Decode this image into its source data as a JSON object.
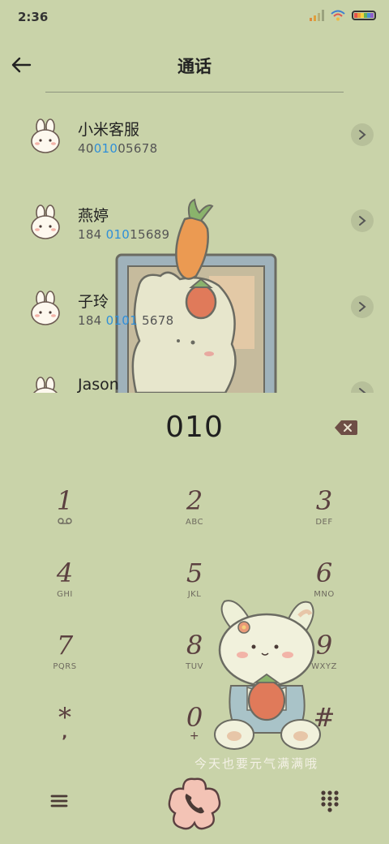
{
  "status": {
    "time": "2:36"
  },
  "header": {
    "title": "通话"
  },
  "contacts": [
    {
      "name": "小米客服",
      "number_pre": "40",
      "number_hl": "010",
      "number_post": "05678"
    },
    {
      "name": "燕婷",
      "number_pre": "184 ",
      "number_hl": "010",
      "number_post": "15689"
    },
    {
      "name": "子玲",
      "number_pre": "184 ",
      "number_hl": "0101",
      "number_post": " 5678"
    },
    {
      "name": "Jason",
      "number_pre": "",
      "number_hl": "",
      "number_post": ""
    }
  ],
  "dial": {
    "number": "010"
  },
  "keys": [
    {
      "digit": "1",
      "letters": ""
    },
    {
      "digit": "2",
      "letters": "ABC"
    },
    {
      "digit": "3",
      "letters": "DEF"
    },
    {
      "digit": "4",
      "letters": "GHI"
    },
    {
      "digit": "5",
      "letters": "JKL"
    },
    {
      "digit": "6",
      "letters": "MNO"
    },
    {
      "digit": "7",
      "letters": "PQRS"
    },
    {
      "digit": "8",
      "letters": "TUV"
    },
    {
      "digit": "9",
      "letters": "WXYZ"
    },
    {
      "digit": "*",
      "letters": ","
    },
    {
      "digit": "0",
      "letters": "+"
    },
    {
      "digit": "#",
      "letters": ""
    }
  ],
  "wallpaper": {
    "slogan": "今天也要元气满满哦"
  },
  "icons": {
    "back": "arrow-left-icon",
    "detail": "chevron-right-icon",
    "backspace": "backspace-icon",
    "voicemail": "voicemail-icon",
    "menu": "menu-icon",
    "call": "phone-icon",
    "keypad": "dialpad-icon"
  },
  "colors": {
    "background": "#c9d3a9",
    "highlight": "#2f8fd8",
    "key_digit": "#5b4040",
    "call_button": "#f3c3b5"
  }
}
